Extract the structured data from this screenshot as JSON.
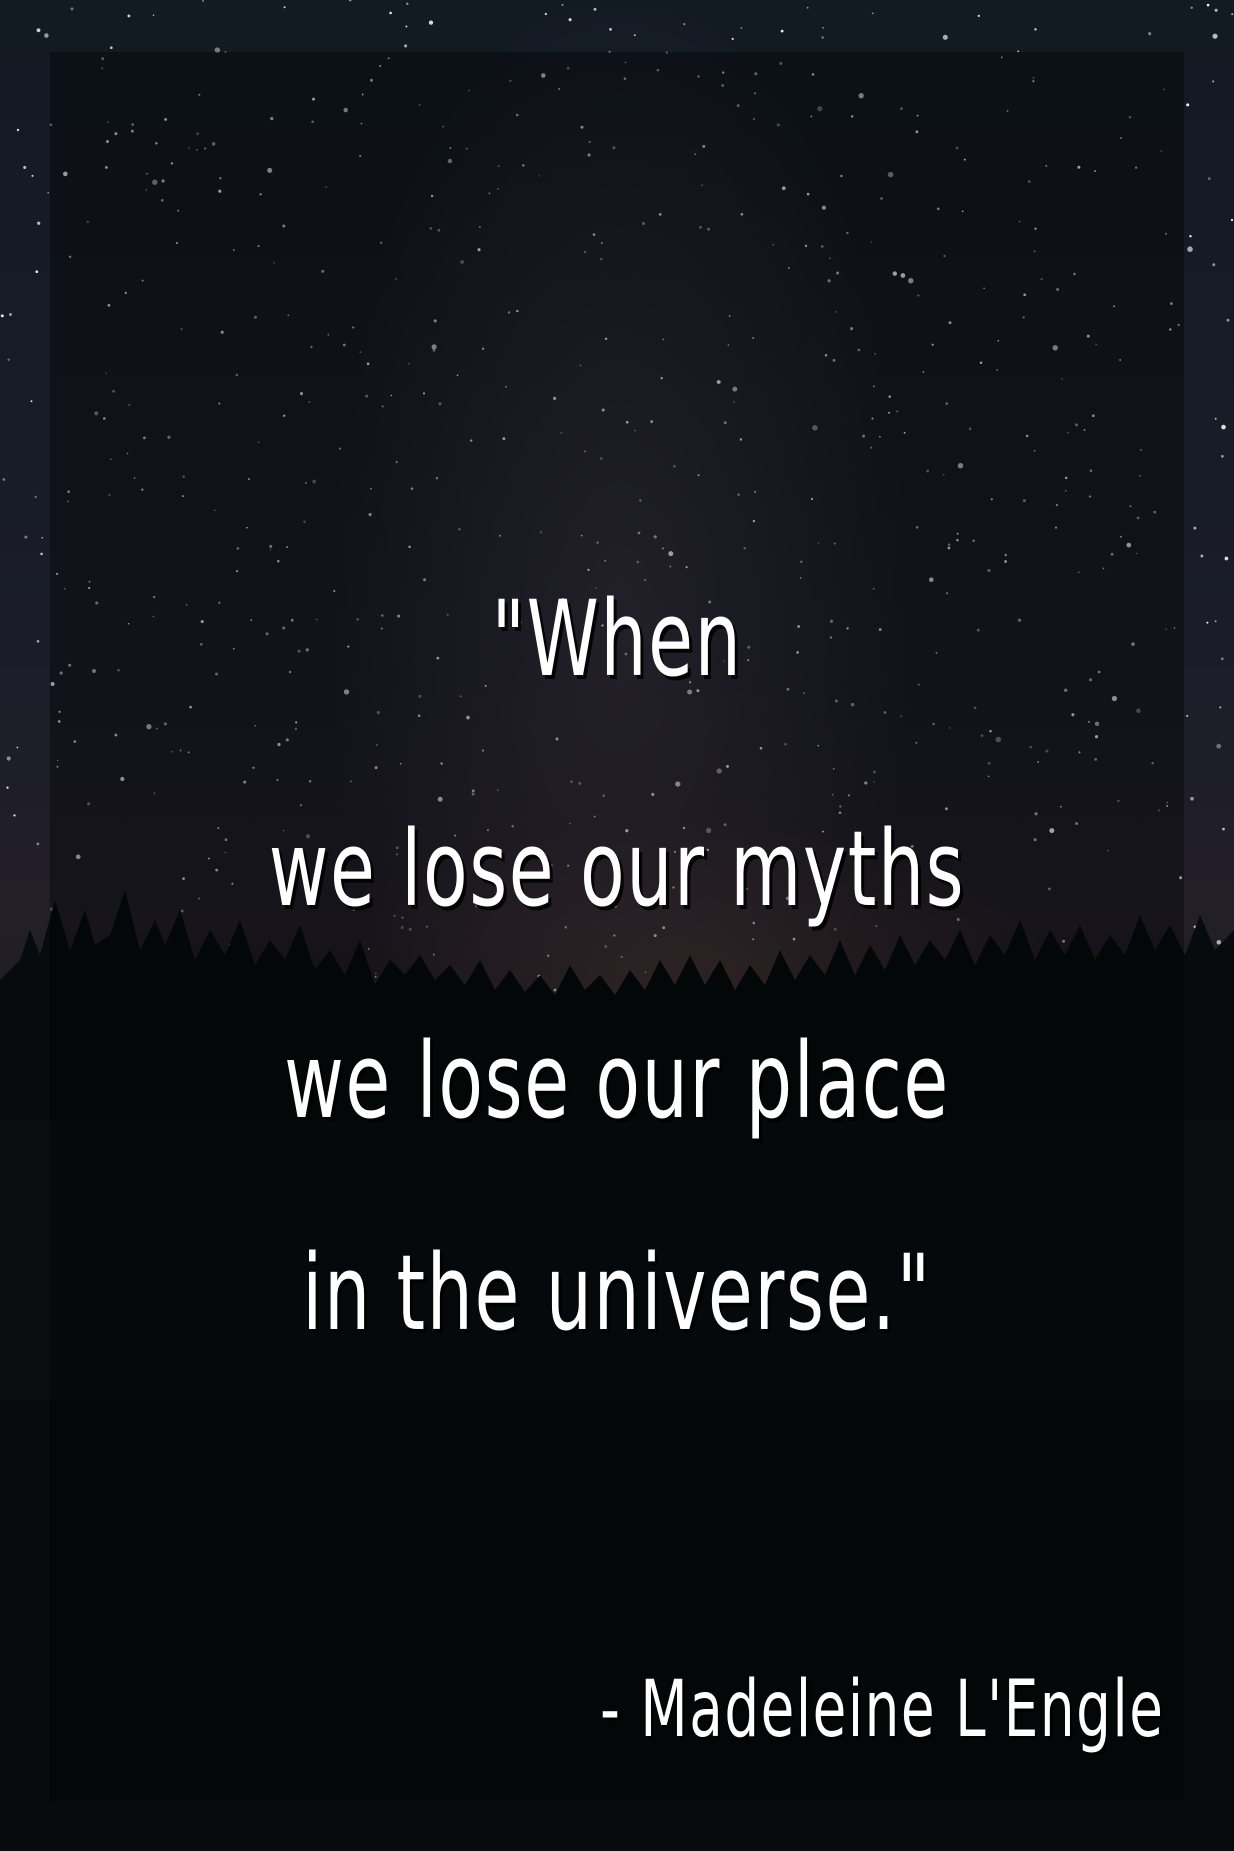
{
  "quote": {
    "lines": [
      "\"When",
      "we lose our myths",
      "we lose our place",
      "in the universe.\""
    ]
  },
  "author": "- Madeleine L'Engle",
  "colors": {
    "sky": "#1a1d28",
    "text": "#ffffff",
    "frame_tint": "#000000"
  }
}
